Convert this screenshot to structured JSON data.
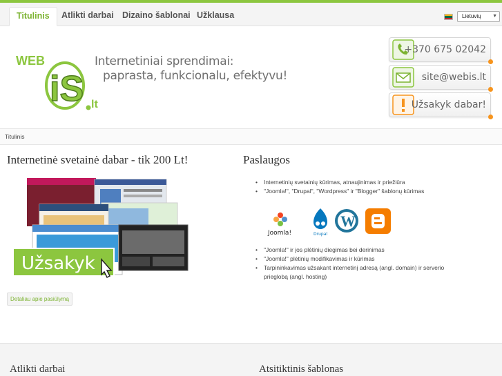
{
  "nav": {
    "tabs": [
      {
        "label": "Titulinis",
        "active": true
      },
      {
        "label": "Atlikti darbai"
      },
      {
        "label": "Dizaino šablonai"
      },
      {
        "label": "Užklausa"
      }
    ],
    "language": "Lietuvių"
  },
  "header": {
    "logo_text": "WEBiS.lt",
    "slogan_line1": "Internetiniai sprendimai:",
    "slogan_line2": "paprasta, funkcionalu, efektyvu!",
    "phone": "+370 675 02042",
    "email": "site@webis.lt",
    "order": "Užsakyk dabar!"
  },
  "breadcrumb": "Titulinis",
  "left": {
    "title": "Internetinė svetainė dabar - tik 200 Lt!",
    "promo_label": "Užsakyk",
    "details_button": "Detaliau apie pasiūlymą"
  },
  "right": {
    "title": "Paslaugos",
    "services_top": [
      "Internetinių svetainių kūrimas, atnaujinimas ir priežiūra",
      "\"Joomla!\", \"Drupal\", \"Wordpress\" ir \"Blogger\" šablonų kūrimas"
    ],
    "cms": [
      "Joomla!",
      "Drupal",
      "Wordpress",
      "Blogger"
    ],
    "services_bottom": [
      "\"Joomla!\" ir jos plėtinių diegimas bei derinimas",
      "\"Joomla!\" plėtinių modifikavimas ir kūrimas",
      "Tarpininkavimas užsakant internetinį adresą (angl. domain) ir serverio prieglobą (angl. hosting)"
    ]
  },
  "footer": {
    "left_title": "Atlikti darbai",
    "right_title": "Atsitiktinis šablonas"
  },
  "colors": {
    "accent": "#8cc63f",
    "accent_text": "#7cb331",
    "orange": "#f7941d"
  }
}
